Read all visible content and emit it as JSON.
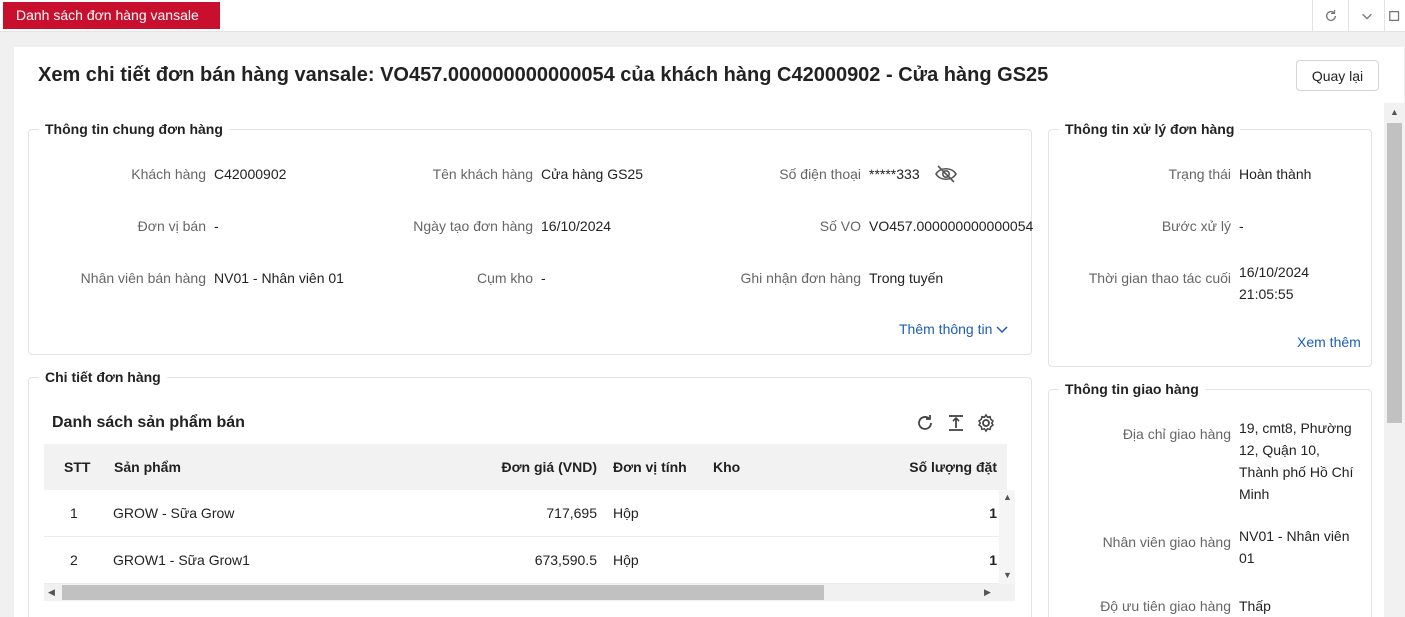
{
  "tabbar": {
    "active_tab": "Danh sách đơn hàng vansale",
    "icons": [
      "refresh-icon",
      "chevron-down-icon",
      "expand-icon"
    ]
  },
  "header": {
    "title": "Xem chi tiết đơn bán hàng vansale: VO457.000000000000054 của khách hàng C42000902 - Cửa hàng GS25",
    "back_label": "Quay lại"
  },
  "general_info": {
    "legend": "Thông tin chung đơn hàng",
    "fields": [
      {
        "label": "Khách hàng",
        "value": "C42000902"
      },
      {
        "label": "Tên khách hàng",
        "value": "Cửa hàng GS25"
      },
      {
        "label": "Số điện thoại",
        "value": "*****333"
      },
      {
        "label": "Đơn vị bán",
        "value": "-"
      },
      {
        "label": "Ngày tạo đơn hàng",
        "value": "16/10/2024"
      },
      {
        "label": "Số VO",
        "value": "VO457.000000000000054"
      },
      {
        "label": "Nhân viên bán hàng",
        "value": "NV01 - Nhân viên 01"
      },
      {
        "label": "Cụm kho",
        "value": "-"
      },
      {
        "label": "Ghi nhận đơn hàng",
        "value": "Trong tuyến"
      }
    ],
    "more_link": "Thêm thông tin"
  },
  "processing_info": {
    "legend": "Thông tin xử lý đơn hàng",
    "fields": [
      {
        "label": "Trạng thái",
        "value": "Hoàn thành"
      },
      {
        "label": "Bước xử lý",
        "value": "-"
      },
      {
        "label": "Thời gian thao tác cuối",
        "value": "16/10/2024\n21:05:55"
      }
    ],
    "more_link": "Xem thêm"
  },
  "order_detail": {
    "legend": "Chi tiết đơn hàng",
    "table_title": "Danh sách sản phẩm bán",
    "columns": [
      "STT",
      "Sản phẩm",
      "Đơn giá (VND)",
      "Đơn vị tính",
      "Kho",
      "Số lượng đặt"
    ],
    "rows": [
      {
        "stt": "1",
        "product": "GROW - Sữa Grow",
        "price": "717,695",
        "unit": "Hộp",
        "warehouse": "",
        "qty": "1"
      },
      {
        "stt": "2",
        "product": "GROW1 - Sữa Grow1",
        "price": "673,590.5",
        "unit": "Hộp",
        "warehouse": "",
        "qty": "1"
      }
    ]
  },
  "delivery_info": {
    "legend": "Thông tin giao hàng",
    "fields": [
      {
        "label": "Địa chỉ giao hàng",
        "value": "19, cmt8, Phường 12, Quận 10, Thành phố Hồ Chí Minh"
      },
      {
        "label": "Nhân viên giao hàng",
        "value": "NV01 - Nhân viên 01"
      },
      {
        "label": "Độ ưu tiên giao hàng",
        "value": "Thấp"
      }
    ]
  }
}
